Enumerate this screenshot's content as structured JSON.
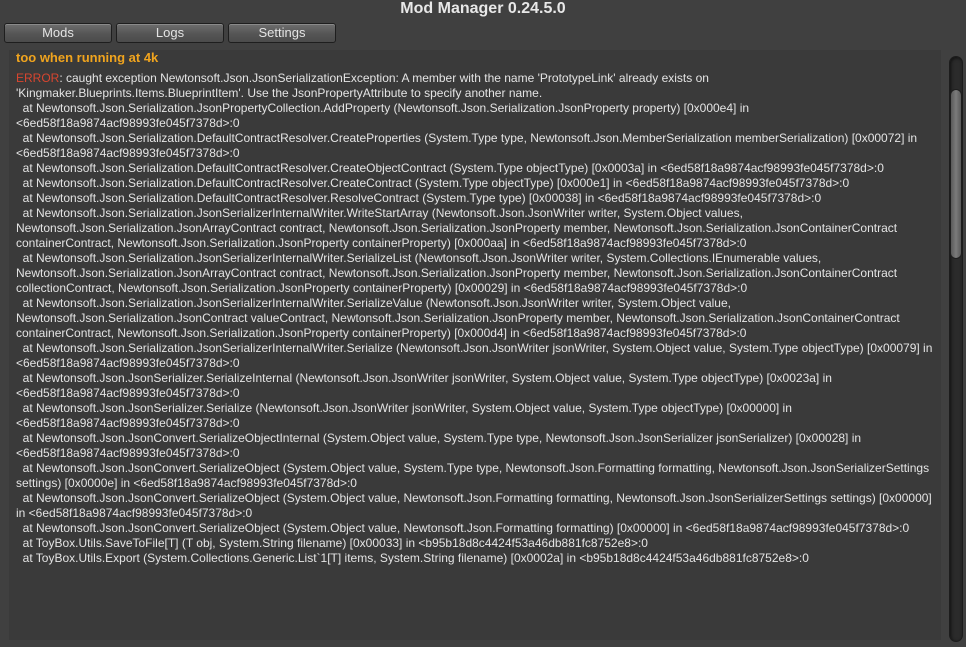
{
  "window": {
    "title": "Mod Manager 0.24.5.0"
  },
  "toolbar": {
    "tabs": [
      {
        "label": "Mods"
      },
      {
        "label": "Logs"
      },
      {
        "label": "Settings"
      }
    ]
  },
  "log": {
    "heading": "too when running at 4k",
    "error_label": "ERROR",
    "error_message": ": caught exception Newtonsoft.Json.JsonSerializationException: A member with the name 'PrototypeLink' already exists on 'Kingmaker.Blueprints.Items.BlueprintItem'. Use the JsonPropertyAttribute to specify another name.",
    "stack": [
      "  at Newtonsoft.Json.Serialization.JsonPropertyCollection.AddProperty (Newtonsoft.Json.Serialization.JsonProperty property) [0x000e4] in <6ed58f18a9874acf98993fe045f7378d>:0",
      "  at Newtonsoft.Json.Serialization.DefaultContractResolver.CreateProperties (System.Type type, Newtonsoft.Json.MemberSerialization memberSerialization) [0x00072] in <6ed58f18a9874acf98993fe045f7378d>:0",
      "  at Newtonsoft.Json.Serialization.DefaultContractResolver.CreateObjectContract (System.Type objectType) [0x0003a] in <6ed58f18a9874acf98993fe045f7378d>:0",
      "  at Newtonsoft.Json.Serialization.DefaultContractResolver.CreateContract (System.Type objectType) [0x000e1] in <6ed58f18a9874acf98993fe045f7378d>:0",
      "  at Newtonsoft.Json.Serialization.DefaultContractResolver.ResolveContract (System.Type type) [0x00038] in <6ed58f18a9874acf98993fe045f7378d>:0",
      "  at Newtonsoft.Json.Serialization.JsonSerializerInternalWriter.WriteStartArray (Newtonsoft.Json.JsonWriter writer, System.Object values, Newtonsoft.Json.Serialization.JsonArrayContract contract, Newtonsoft.Json.Serialization.JsonProperty member, Newtonsoft.Json.Serialization.JsonContainerContract containerContract, Newtonsoft.Json.Serialization.JsonProperty containerProperty) [0x000aa] in <6ed58f18a9874acf98993fe045f7378d>:0",
      "  at Newtonsoft.Json.Serialization.JsonSerializerInternalWriter.SerializeList (Newtonsoft.Json.JsonWriter writer, System.Collections.IEnumerable values, Newtonsoft.Json.Serialization.JsonArrayContract contract, Newtonsoft.Json.Serialization.JsonProperty member, Newtonsoft.Json.Serialization.JsonContainerContract collectionContract, Newtonsoft.Json.Serialization.JsonProperty containerProperty) [0x00029] in <6ed58f18a9874acf98993fe045f7378d>:0",
      "  at Newtonsoft.Json.Serialization.JsonSerializerInternalWriter.SerializeValue (Newtonsoft.Json.JsonWriter writer, System.Object value, Newtonsoft.Json.Serialization.JsonContract valueContract, Newtonsoft.Json.Serialization.JsonProperty member, Newtonsoft.Json.Serialization.JsonContainerContract containerContract, Newtonsoft.Json.Serialization.JsonProperty containerProperty) [0x000d4] in <6ed58f18a9874acf98993fe045f7378d>:0",
      "  at Newtonsoft.Json.Serialization.JsonSerializerInternalWriter.Serialize (Newtonsoft.Json.JsonWriter jsonWriter, System.Object value, System.Type objectType) [0x00079] in <6ed58f18a9874acf98993fe045f7378d>:0",
      "  at Newtonsoft.Json.JsonSerializer.SerializeInternal (Newtonsoft.Json.JsonWriter jsonWriter, System.Object value, System.Type objectType) [0x0023a] in <6ed58f18a9874acf98993fe045f7378d>:0",
      "  at Newtonsoft.Json.JsonSerializer.Serialize (Newtonsoft.Json.JsonWriter jsonWriter, System.Object value, System.Type objectType) [0x00000] in <6ed58f18a9874acf98993fe045f7378d>:0",
      "  at Newtonsoft.Json.JsonConvert.SerializeObjectInternal (System.Object value, System.Type type, Newtonsoft.Json.JsonSerializer jsonSerializer) [0x00028] in <6ed58f18a9874acf98993fe045f7378d>:0",
      "  at Newtonsoft.Json.JsonConvert.SerializeObject (System.Object value, System.Type type, Newtonsoft.Json.Formatting formatting, Newtonsoft.Json.JsonSerializerSettings settings) [0x0000e] in <6ed58f18a9874acf98993fe045f7378d>:0",
      "  at Newtonsoft.Json.JsonConvert.SerializeObject (System.Object value, Newtonsoft.Json.Formatting formatting, Newtonsoft.Json.JsonSerializerSettings settings) [0x00000] in <6ed58f18a9874acf98993fe045f7378d>:0",
      "  at Newtonsoft.Json.JsonConvert.SerializeObject (System.Object value, Newtonsoft.Json.Formatting formatting) [0x00000] in <6ed58f18a9874acf98993fe045f7378d>:0",
      "  at ToyBox.Utils.SaveToFile[T] (T obj, System.String filename) [0x00033] in <b95b18d8c4424f53a46db881fc8752e8>:0",
      "  at ToyBox.Utils.Export (System.Collections.Generic.List`1[T] items, System.String filename) [0x0002a] in <b95b18d8c4424f53a46db881fc8752e8>:0"
    ]
  },
  "colors": {
    "heading": "#f0a41e",
    "error": "#d8452f",
    "text": "#e4e4e4",
    "background": "#404040"
  }
}
